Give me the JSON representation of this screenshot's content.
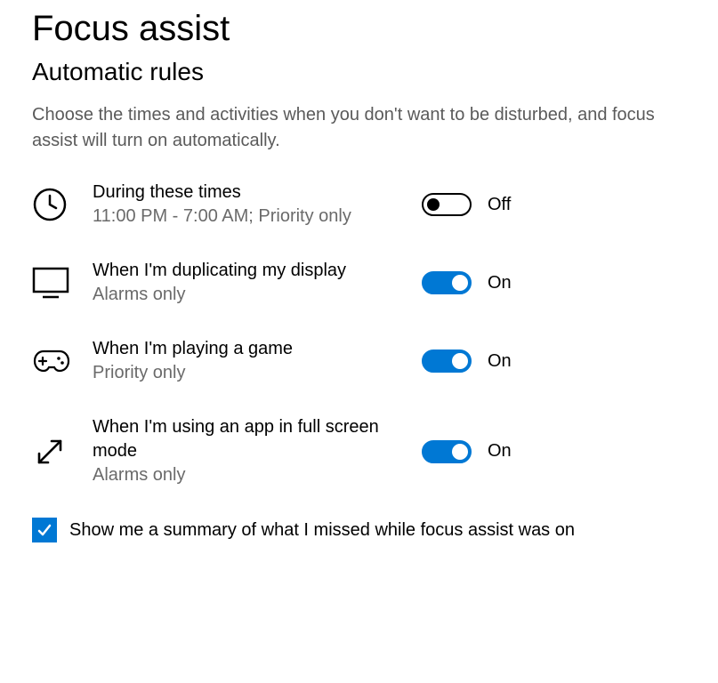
{
  "page": {
    "title": "Focus assist",
    "section": "Automatic rules",
    "description": "Choose the times and activities when you don't want to be disturbed, and focus assist will turn on automatically."
  },
  "rules": [
    {
      "title": "During these times",
      "sub": "11:00 PM - 7:00 AM; Priority only",
      "state": "off",
      "stateLabel": "Off"
    },
    {
      "title": "When I'm duplicating my display",
      "sub": "Alarms only",
      "state": "on",
      "stateLabel": "On"
    },
    {
      "title": "When I'm playing a game",
      "sub": "Priority only",
      "state": "on",
      "stateLabel": "On"
    },
    {
      "title": "When I'm using an app in full screen mode",
      "sub": "Alarms only",
      "state": "on",
      "stateLabel": "On"
    }
  ],
  "summary": {
    "checked": true,
    "label": "Show me a summary of what I missed while focus assist was on"
  }
}
